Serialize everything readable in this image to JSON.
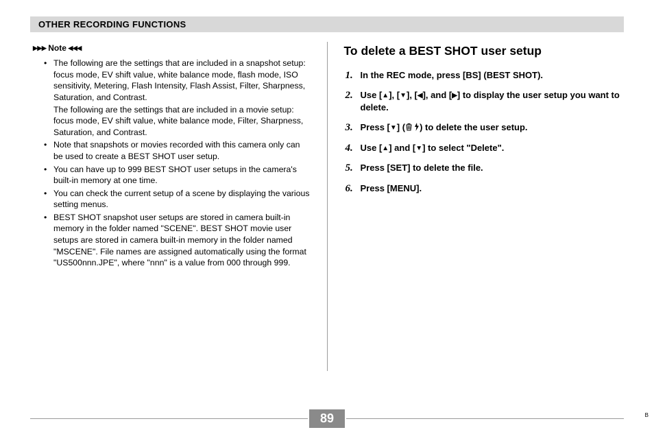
{
  "header": "OTHER RECORDING FUNCTIONS",
  "note_label": "Note",
  "notes": {
    "item1a": "The following are the settings that are included in a snapshot setup: focus mode, EV shift value, white balance mode, flash mode, ISO sensitivity, Metering, Flash Intensity, Flash Assist, Filter, Sharpness, Saturation, and Contrast.",
    "item1b": "The following are the settings that are included in a movie setup: focus mode, EV shift value, white balance mode, Filter, Sharpness, Saturation, and Contrast.",
    "item2": "Note that snapshots or movies recorded with this camera only can be used to create a BEST SHOT user setup.",
    "item3": "You can have up to 999 BEST SHOT user setups in the camera's built-in memory at one time.",
    "item4": "You can check the current setup of a scene by displaying the various setting menus.",
    "item5": "BEST SHOT snapshot user setups are stored in camera built-in memory in the folder named \"SCENE\". BEST SHOT movie user setups are stored in camera built-in memory in the folder named \"MSCENE\". File names are assigned automatically using the format \"US500nnn.JPE\", where \"nnn\" is a value from 000 through 999."
  },
  "right": {
    "title": "To delete a BEST SHOT user setup",
    "step1": "In the REC mode, press [BS] (BEST SHOT).",
    "step2a": "Use [",
    "step2b": "], [",
    "step2c": "], [",
    "step2d": "], and [",
    "step2e": "] to display the user setup you want to delete.",
    "step3a": "Press [",
    "step3b": "] (",
    "step3c": ") to delete the user setup.",
    "step4a": "Use [",
    "step4b": "] and [",
    "step4c": "] to select \"Delete\".",
    "step5": "Press [SET] to delete the file.",
    "step6": "Press [MENU]."
  },
  "page_number": "89",
  "footer_mark": "B"
}
